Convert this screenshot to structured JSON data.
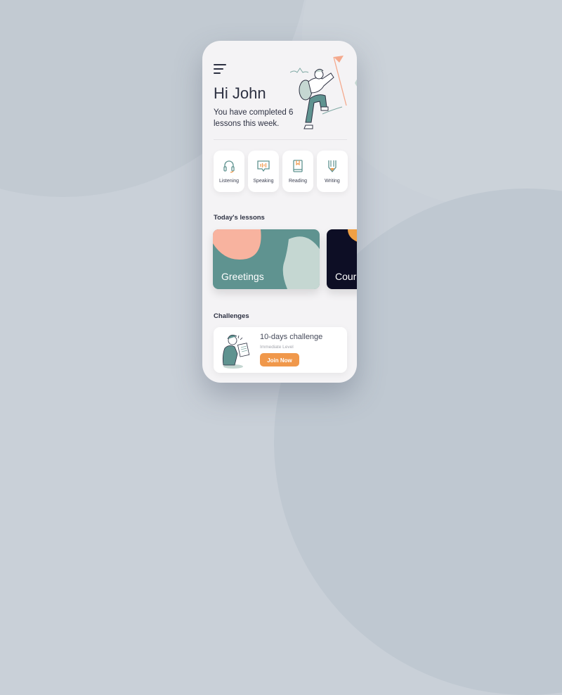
{
  "header": {
    "greeting": "Hi John",
    "subtitle": "You have completed 6 lessons this week."
  },
  "categories": [
    {
      "label": "Listening",
      "icon": "headphones-icon"
    },
    {
      "label": "Speaking",
      "icon": "speech-bubble-icon"
    },
    {
      "label": "Reading",
      "icon": "book-icon"
    },
    {
      "label": "Writing",
      "icon": "pencil-icon"
    }
  ],
  "lessons": {
    "heading": "Today's lessons",
    "items": [
      {
        "title": "Greetings"
      },
      {
        "title": "Cour"
      }
    ]
  },
  "challenges": {
    "heading": "Challenges",
    "item": {
      "title": "10-days challenge",
      "level": "Immediate Level",
      "button": "Join Now"
    }
  },
  "colors": {
    "teal": "#5f9390",
    "salmon": "#f8b39f",
    "mint": "#c5d7d2",
    "navy": "#0d0e25",
    "orange": "#f0984b"
  }
}
